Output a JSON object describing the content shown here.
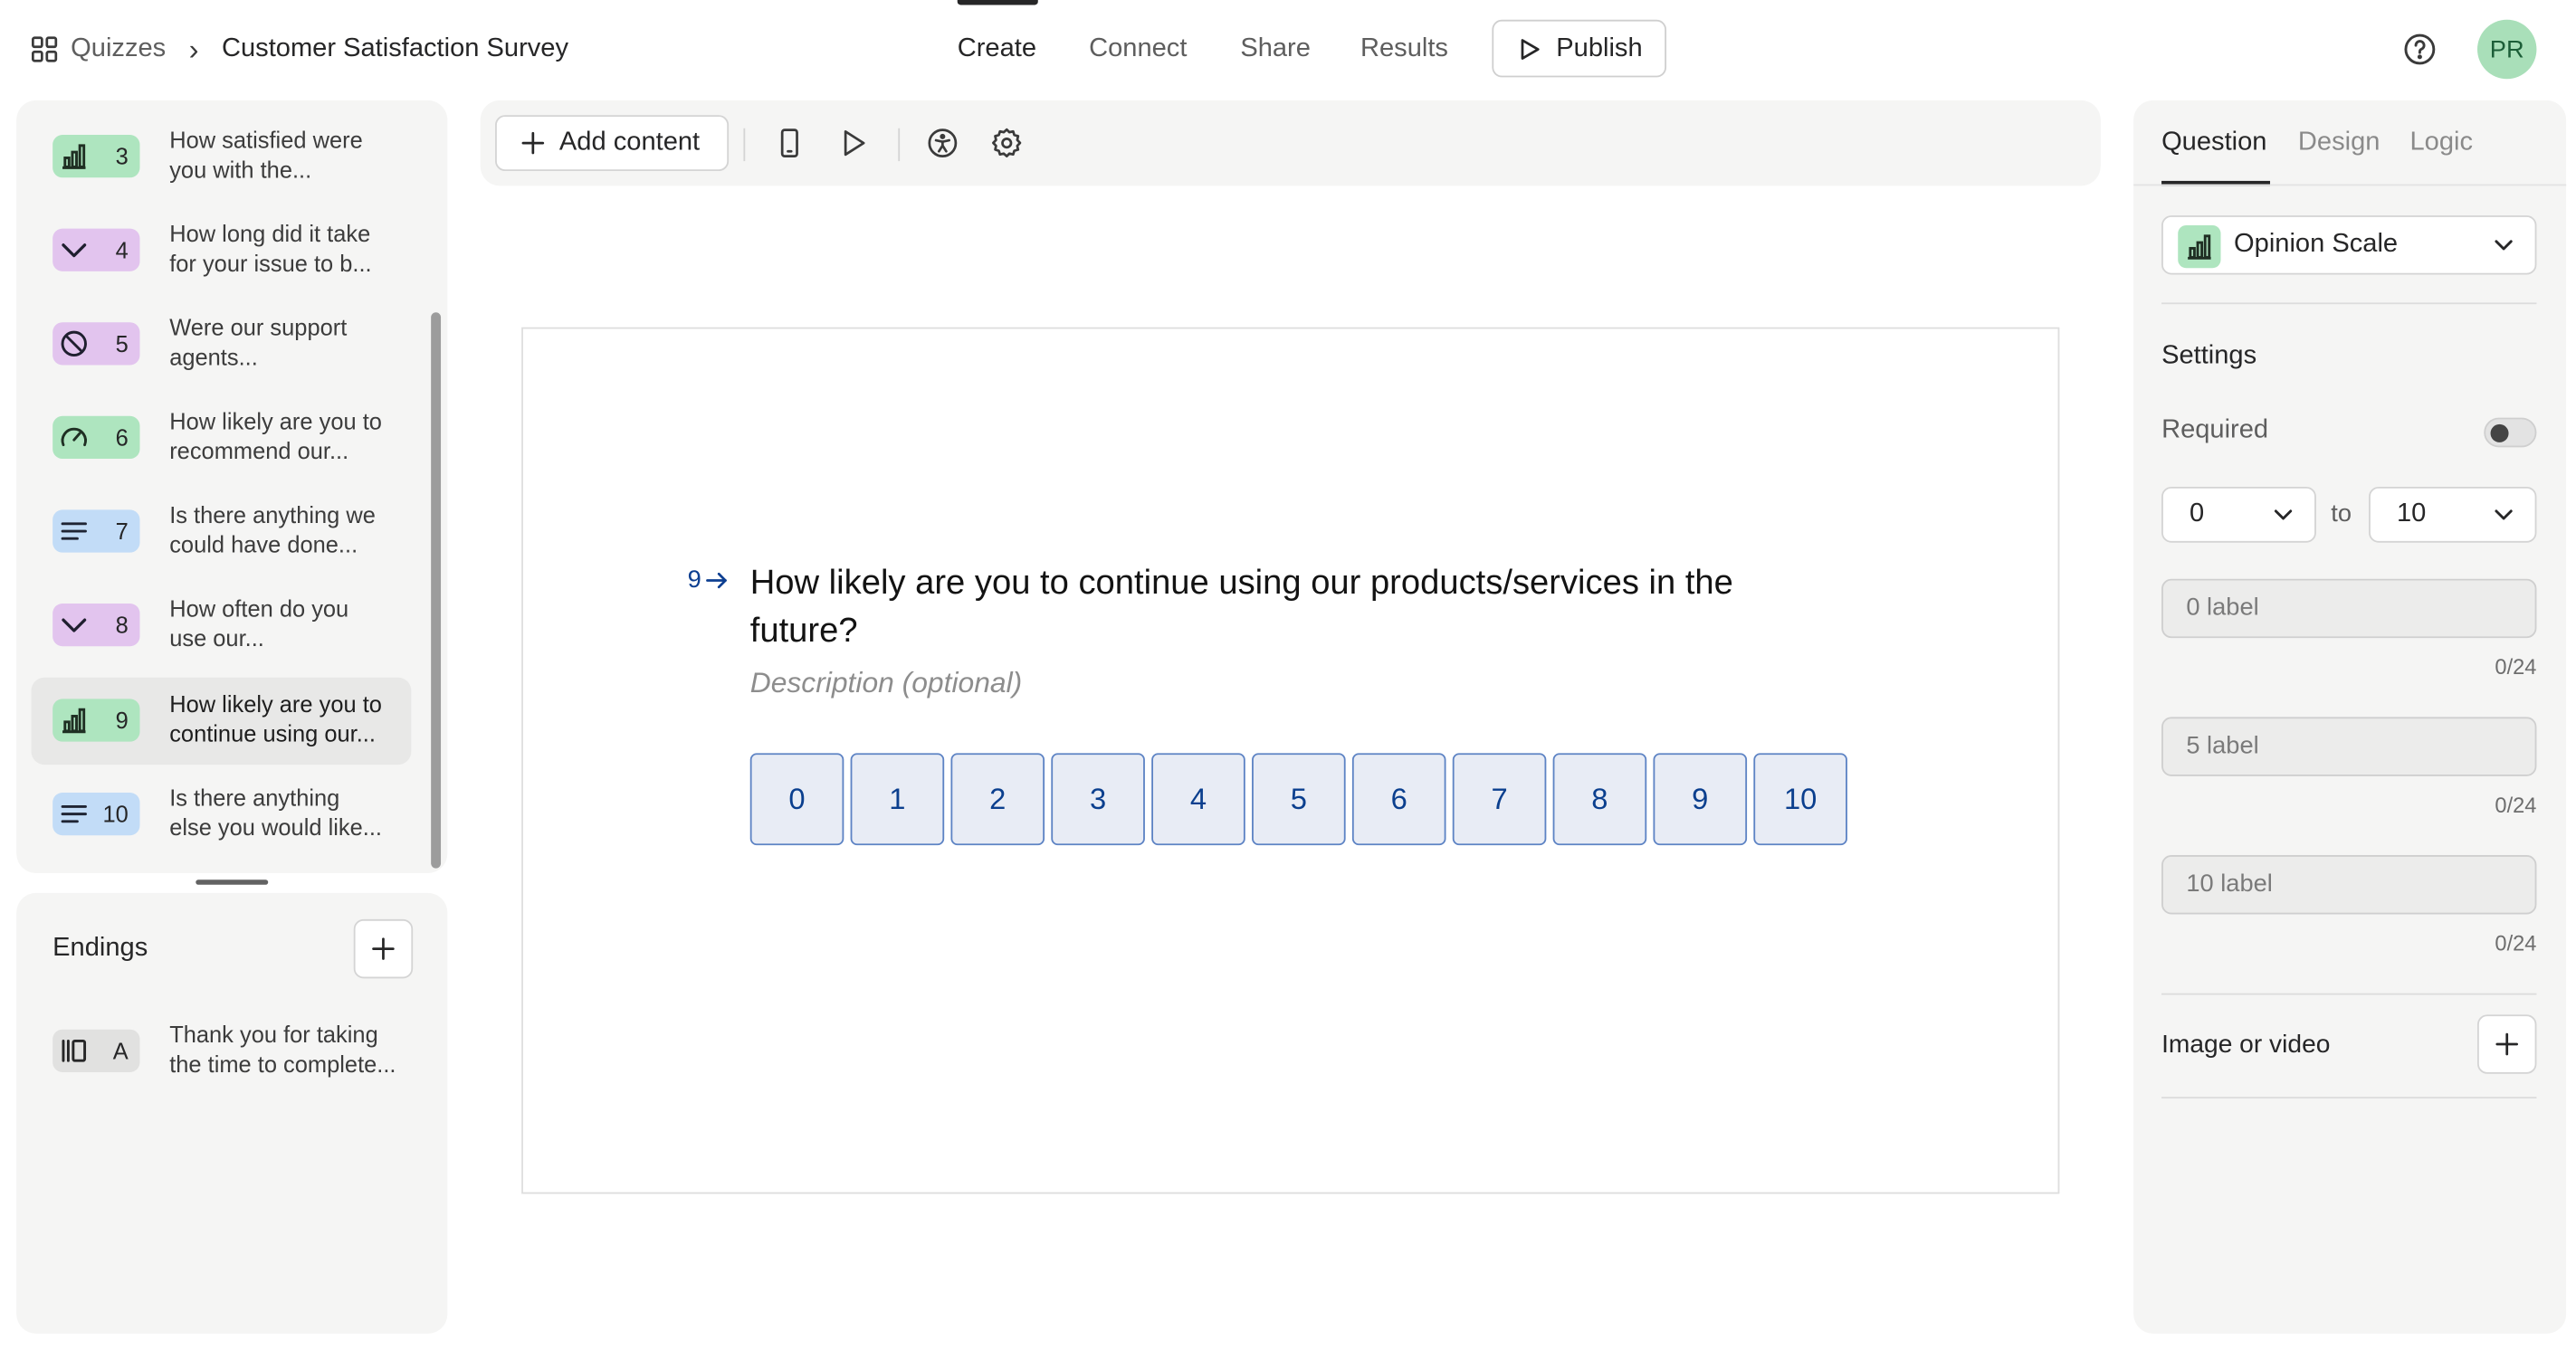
{
  "breadcrumb": {
    "root": "Quizzes",
    "separator": "›",
    "current": "Customer Satisfaction Survey"
  },
  "nav": {
    "tabs": [
      "Create",
      "Connect",
      "Share",
      "Results"
    ],
    "active": "Create",
    "publish": "Publish"
  },
  "user": {
    "initials": "PR"
  },
  "questions": [
    {
      "num": "3",
      "type": "opinion-scale",
      "icon": "bar-chart-icon",
      "color": "#aee5bf",
      "line1": "How satisfied were",
      "line2": "you with the..."
    },
    {
      "num": "4",
      "type": "dropdown",
      "icon": "chevron-down-icon",
      "color": "#e2c4ee",
      "line1": "How long did it take",
      "line2": "for your issue to b..."
    },
    {
      "num": "5",
      "type": "yes-no",
      "icon": "circle-slash-icon",
      "color": "#e2c4ee",
      "line1": "Were our support",
      "line2": "agents..."
    },
    {
      "num": "6",
      "type": "nps",
      "icon": "gauge-icon",
      "color": "#aee5bf",
      "line1": "How likely are you to",
      "line2": "recommend our..."
    },
    {
      "num": "7",
      "type": "long-text",
      "icon": "text-lines-icon",
      "color": "#c2dcf7",
      "line1": "Is there anything we",
      "line2": "could have done..."
    },
    {
      "num": "8",
      "type": "dropdown",
      "icon": "chevron-down-icon",
      "color": "#e2c4ee",
      "line1": "How often do you",
      "line2": "use our..."
    },
    {
      "num": "9",
      "type": "opinion-scale",
      "icon": "bar-chart-icon",
      "color": "#aee5bf",
      "line1": "How likely are you to",
      "line2": "continue using our...",
      "selected": true
    },
    {
      "num": "10",
      "type": "long-text",
      "icon": "text-lines-icon",
      "color": "#c2dcf7",
      "line1": "Is there anything",
      "line2": "else you would like..."
    }
  ],
  "endings": {
    "title": "Endings",
    "items": [
      {
        "letter": "A",
        "icon": "ending-icon",
        "line1": "Thank you for taking",
        "line2": "the time to complete..."
      }
    ]
  },
  "toolbar": {
    "add_content": "Add content"
  },
  "editor": {
    "number": "9",
    "title": "How likely are you to continue using our products/services in the future?",
    "description_placeholder": "Description (optional)",
    "scale": [
      "0",
      "1",
      "2",
      "3",
      "4",
      "5",
      "6",
      "7",
      "8",
      "9",
      "10"
    ]
  },
  "settings_panel": {
    "tabs": [
      "Question",
      "Design",
      "Logic"
    ],
    "active_tab": "Question",
    "question_type": "Opinion Scale",
    "settings_title": "Settings",
    "required_label": "Required",
    "required": false,
    "range_from": "0",
    "range_to_label": "to",
    "range_to": "10",
    "labels": [
      {
        "placeholder": "0 label",
        "counter": "0/24"
      },
      {
        "placeholder": "5 label",
        "counter": "0/24"
      },
      {
        "placeholder": "10 label",
        "counter": "0/24"
      }
    ],
    "media_label": "Image or video"
  }
}
